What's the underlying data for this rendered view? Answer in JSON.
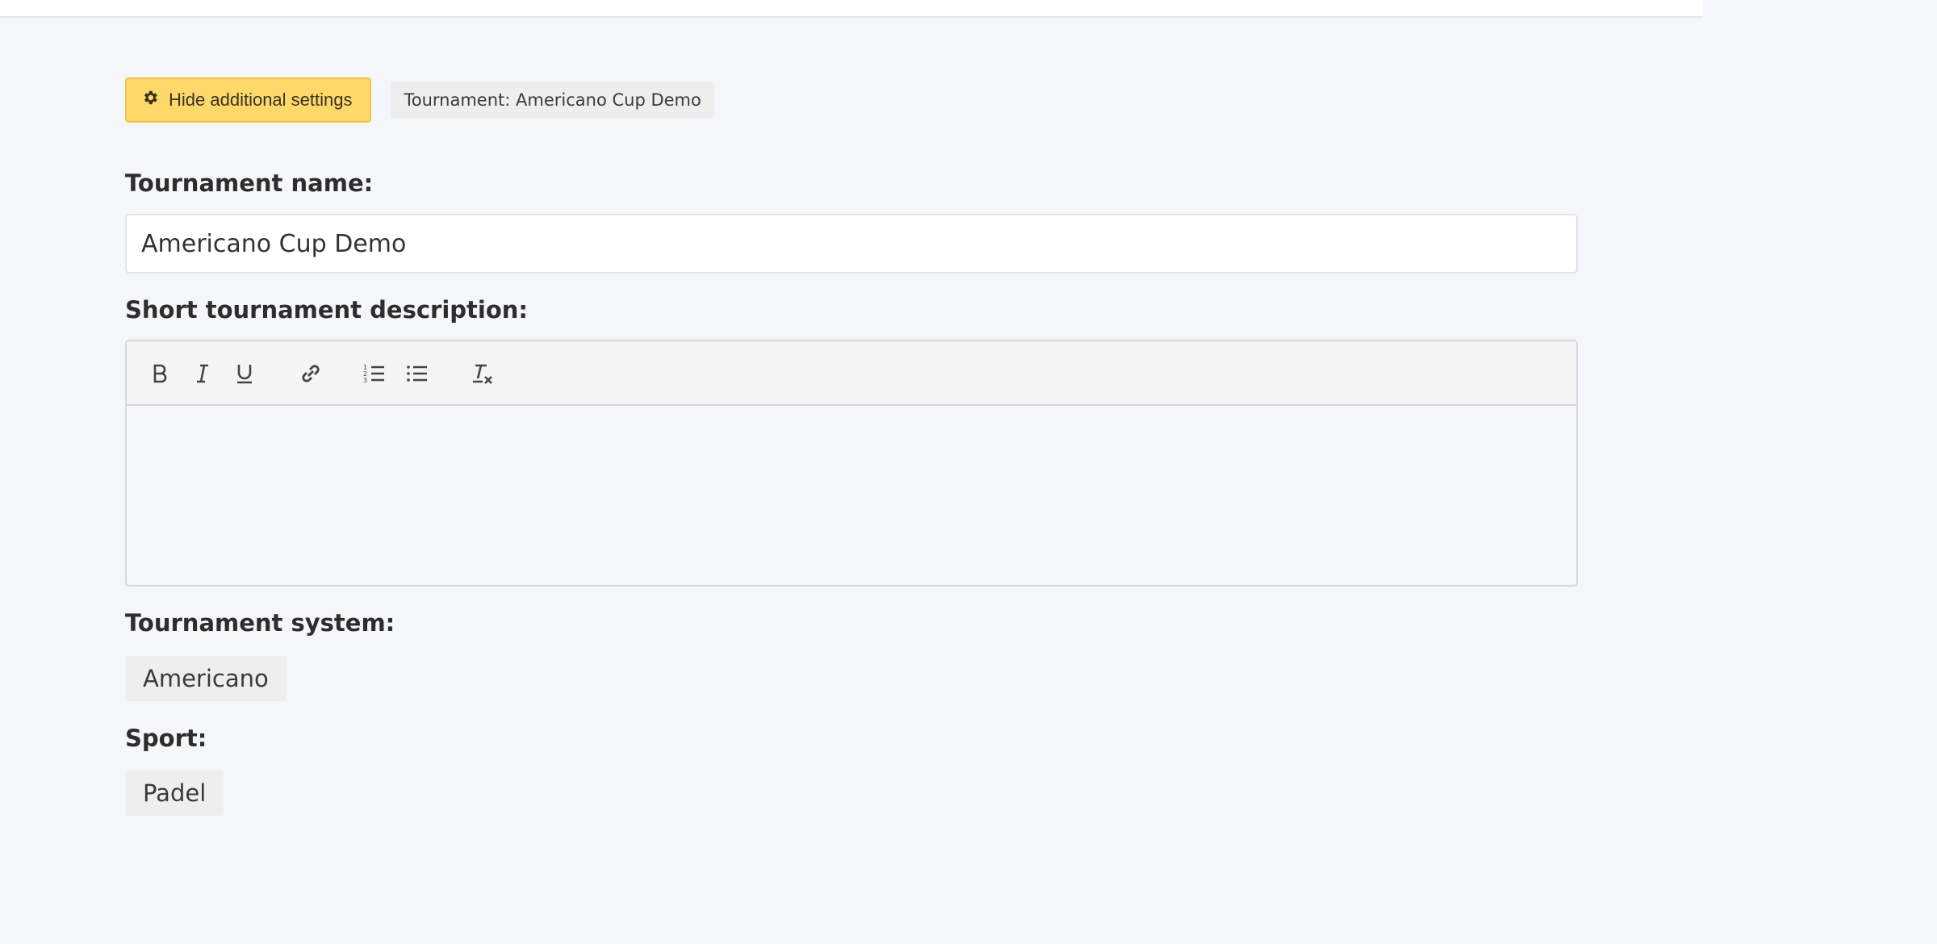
{
  "toolbar": {
    "hide_settings_label": "Hide additional settings",
    "settings_icon": "gear-icon",
    "tournament_badge": "Tournament: Americano Cup Demo",
    "accent_color": "#ffd86b"
  },
  "form": {
    "name_label": "Tournament name:",
    "name_value": "Americano Cup Demo",
    "description_label": "Short tournament description:",
    "description_value": "",
    "system_label": "Tournament system:",
    "system_value": "Americano",
    "sport_label": "Sport:",
    "sport_value": "Padel"
  },
  "editor_toolbar": {
    "icons": [
      "bold-icon",
      "italic-icon",
      "underline-icon",
      "link-icon",
      "ordered-list-icon",
      "bullet-list-icon",
      "clear-format-icon"
    ]
  }
}
